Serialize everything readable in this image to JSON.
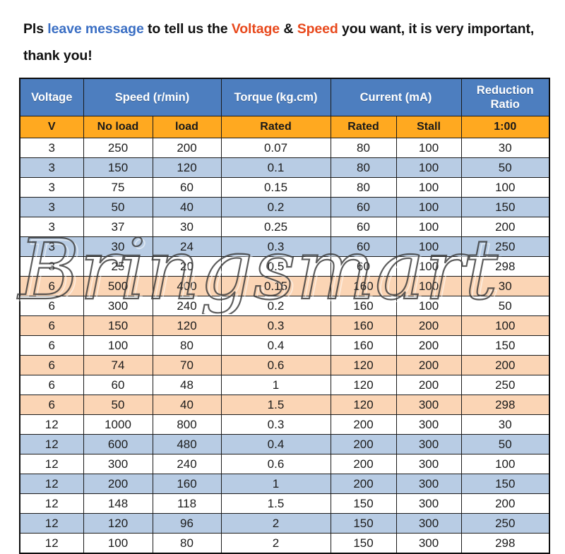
{
  "intro": {
    "part1": "Pls ",
    "highlight1": "leave message",
    "part2": " to tell us the ",
    "highlight2": "Voltage",
    "part3": " & ",
    "highlight3": "Speed",
    "part4": " you want, it is very important, thank you!"
  },
  "watermark": {
    "text": "Bringsmart"
  },
  "colors": {
    "header_blue": "#4d7ebf",
    "header_orange": "#ffa920",
    "stripe_blue": "#b8cce4",
    "stripe_peach": "#fbd5b5",
    "accent_blue_text": "#3b6fc4",
    "accent_orange_text": "#e8491d",
    "border": "#1a1a1a"
  },
  "table": {
    "group_headers": [
      {
        "label": "Voltage",
        "colspan": 1
      },
      {
        "label": "Speed (r/min)",
        "colspan": 2
      },
      {
        "label": "Torque (kg.cm)",
        "colspan": 1
      },
      {
        "label": "Current (mA)",
        "colspan": 2
      },
      {
        "label": "Reduction Ratio",
        "colspan": 1
      }
    ],
    "sub_headers": [
      "V",
      "No load",
      "load",
      "Rated",
      "Rated",
      "Stall",
      "1:00"
    ],
    "rows": [
      {
        "stripe": "plain",
        "cells": [
          "3",
          "250",
          "200",
          "0.07",
          "80",
          "100",
          "30"
        ]
      },
      {
        "stripe": "alt-blue",
        "cells": [
          "3",
          "150",
          "120",
          "0.1",
          "80",
          "100",
          "50"
        ]
      },
      {
        "stripe": "plain",
        "cells": [
          "3",
          "75",
          "60",
          "0.15",
          "80",
          "100",
          "100"
        ]
      },
      {
        "stripe": "alt-blue",
        "cells": [
          "3",
          "50",
          "40",
          "0.2",
          "60",
          "100",
          "150"
        ]
      },
      {
        "stripe": "plain",
        "cells": [
          "3",
          "37",
          "30",
          "0.25",
          "60",
          "100",
          "200"
        ]
      },
      {
        "stripe": "alt-blue",
        "cells": [
          "3",
          "30",
          "24",
          "0.3",
          "60",
          "100",
          "250"
        ]
      },
      {
        "stripe": "plain",
        "cells": [
          "3",
          "25",
          "20",
          "0.5",
          "60",
          "100",
          "298"
        ]
      },
      {
        "stripe": "alt-peach",
        "cells": [
          "6",
          "500",
          "400",
          "0.15",
          "160",
          "100",
          "30"
        ]
      },
      {
        "stripe": "plain",
        "cells": [
          "6",
          "300",
          "240",
          "0.2",
          "160",
          "100",
          "50"
        ]
      },
      {
        "stripe": "alt-peach",
        "cells": [
          "6",
          "150",
          "120",
          "0.3",
          "160",
          "200",
          "100"
        ]
      },
      {
        "stripe": "plain",
        "cells": [
          "6",
          "100",
          "80",
          "0.4",
          "160",
          "200",
          "150"
        ]
      },
      {
        "stripe": "alt-peach",
        "cells": [
          "6",
          "74",
          "70",
          "0.6",
          "120",
          "200",
          "200"
        ]
      },
      {
        "stripe": "plain",
        "cells": [
          "6",
          "60",
          "48",
          "1",
          "120",
          "200",
          "250"
        ]
      },
      {
        "stripe": "alt-peach",
        "cells": [
          "6",
          "50",
          "40",
          "1.5",
          "120",
          "300",
          "298"
        ]
      },
      {
        "stripe": "plain",
        "cells": [
          "12",
          "1000",
          "800",
          "0.3",
          "200",
          "300",
          "30"
        ]
      },
      {
        "stripe": "alt-blue",
        "cells": [
          "12",
          "600",
          "480",
          "0.4",
          "200",
          "300",
          "50"
        ]
      },
      {
        "stripe": "plain",
        "cells": [
          "12",
          "300",
          "240",
          "0.6",
          "200",
          "300",
          "100"
        ]
      },
      {
        "stripe": "alt-blue",
        "cells": [
          "12",
          "200",
          "160",
          "1",
          "200",
          "300",
          "150"
        ]
      },
      {
        "stripe": "plain",
        "cells": [
          "12",
          "148",
          "118",
          "1.5",
          "150",
          "300",
          "200"
        ]
      },
      {
        "stripe": "alt-blue",
        "cells": [
          "12",
          "120",
          "96",
          "2",
          "150",
          "300",
          "250"
        ]
      },
      {
        "stripe": "plain",
        "cells": [
          "12",
          "100",
          "80",
          "2",
          "150",
          "300",
          "298"
        ]
      }
    ]
  }
}
